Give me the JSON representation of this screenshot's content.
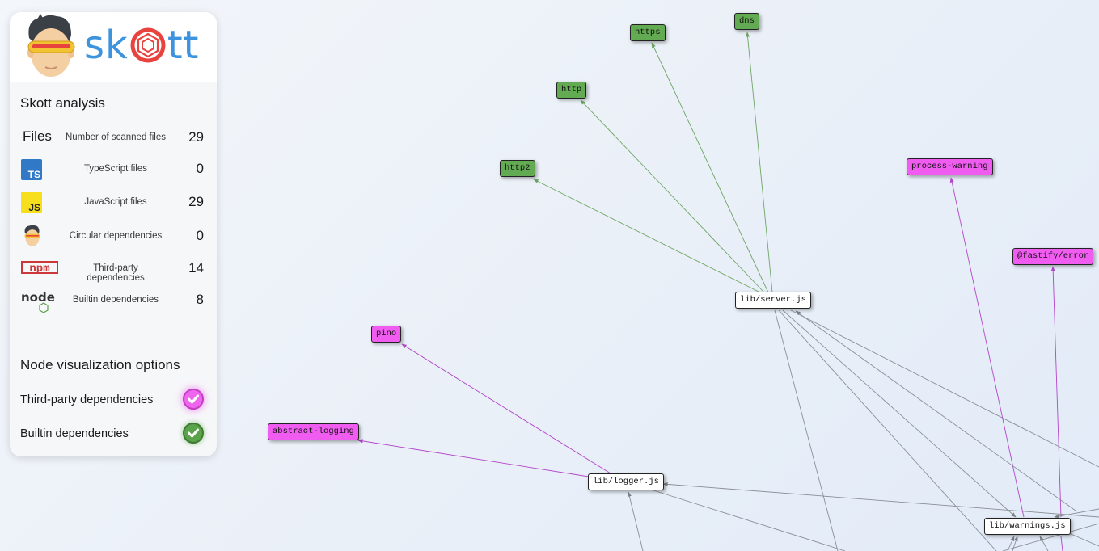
{
  "app": {
    "name": "skott"
  },
  "analysis": {
    "title": "Skott analysis",
    "files_label": "Files",
    "rows": [
      {
        "icon": "files",
        "label": "Number of scanned files",
        "value": "29"
      },
      {
        "icon": "typescript-icon",
        "label": "TypeScript files",
        "value": "0"
      },
      {
        "icon": "javascript-icon",
        "label": "JavaScript files",
        "value": "29"
      },
      {
        "icon": "skott-mascot-icon",
        "label": "Circular dependencies",
        "value": "0"
      },
      {
        "icon": "npm-icon",
        "label": "Third-party dependencies",
        "value": "14"
      },
      {
        "icon": "nodejs-icon",
        "label": "Builtin dependencies",
        "value": "8"
      }
    ],
    "ts_badge": "TS",
    "js_badge": "JS",
    "npm_badge": "npm",
    "node_badge": "node"
  },
  "options": {
    "title": "Node visualization options",
    "third_party": {
      "label": "Third-party dependencies",
      "checked": true,
      "color": "#e855e8"
    },
    "builtin": {
      "label": "Builtin dependencies",
      "checked": true,
      "color": "#4e9a3f"
    }
  },
  "colors": {
    "file_node": "#ffffff",
    "third_party_node": "#f05cf0",
    "builtin_node": "#63ab52",
    "third_party_edge": "#b246c9",
    "builtin_edge": "#6fa564",
    "file_edge": "#8a8f96",
    "logo_blue": "#3d93dd",
    "logo_red": "#e8433f"
  },
  "graph": {
    "nodes": {
      "https": "https",
      "dns": "dns",
      "http": "http",
      "http2": "http2",
      "process_warning": "process-warning",
      "fastify_error": "@fastify/error",
      "server": "lib/server.js",
      "pino": "pino",
      "abstract_logging": "abstract-logging",
      "logger": "lib/logger.js",
      "warnings": "lib/warnings.js"
    }
  }
}
